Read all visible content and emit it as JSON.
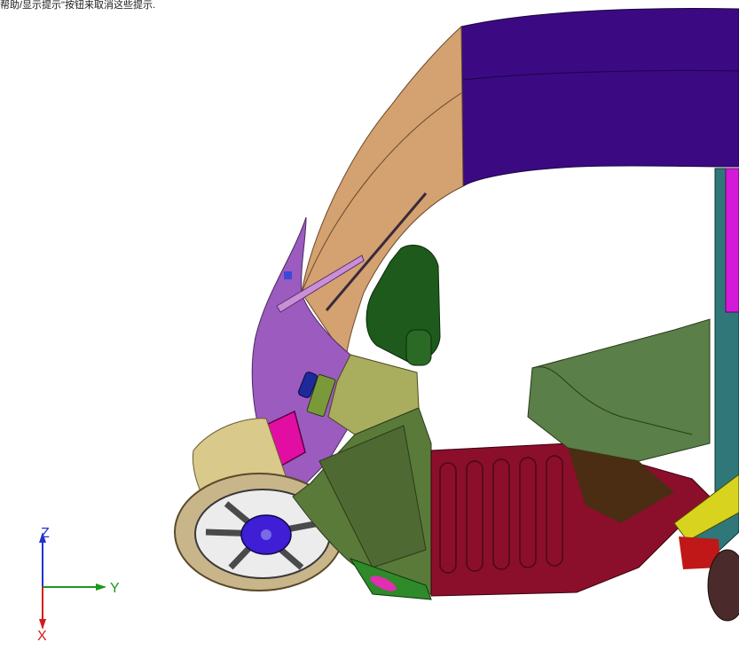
{
  "hint_text": "帮助/显示提示\"按钮来取消这些提示.",
  "viewport": {
    "colors": {
      "roof": "#3b0a82",
      "pillar": "#d4a171",
      "front_panel": "#9b5bbf",
      "headlamp": "#e20ea4",
      "fender": "#d9c98a",
      "wheel_hub": "#3f1ed6",
      "body_green": "#5a7a3a",
      "olive": "#a9ad5e",
      "floor": "#8b0f2a",
      "teal": "#2f7778",
      "seat": "#5a7f48",
      "seat_dark": "#4a2d12",
      "motor": "#1e5a1c",
      "magenta_post": "#d21ad8",
      "yellow": "#d8d31e"
    }
  },
  "triad": {
    "z_label": "Z",
    "y_label": "Y",
    "x_label": "X",
    "z_color": "#2233cc",
    "y_color": "#1a9a1a",
    "x_color": "#d41a1a"
  }
}
